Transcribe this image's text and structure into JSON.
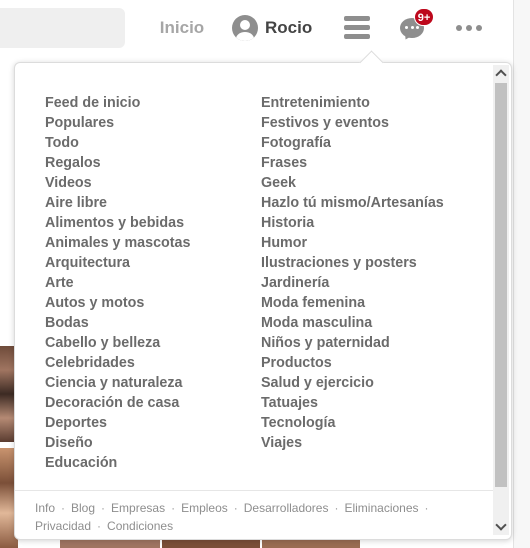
{
  "header": {
    "search_placeholder": "",
    "home_label": "Inicio",
    "profile_name": "Rocio",
    "notifications_badge": "9+"
  },
  "icons": {
    "avatar": "user-avatar-icon",
    "menu": "hamburger-menu-icon",
    "messages": "chat-bubble-icon",
    "more": "more-options-icon"
  },
  "colors": {
    "badge": "#bd081c",
    "category_text": "#6b6b6b",
    "footer_text": "#8e8e8e"
  },
  "categories": {
    "left": [
      "Feed de inicio",
      "Populares",
      "Todo",
      "Regalos",
      "Videos",
      "Aire libre",
      "Alimentos y bebidas",
      "Animales y mascotas",
      "Arquitectura",
      "Arte",
      "Autos y motos",
      "Bodas",
      "Cabello y belleza",
      "Celebridades",
      "Ciencia y naturaleza",
      "Decoración de casa",
      "Deportes",
      "Diseño",
      "Educación"
    ],
    "right": [
      "Entretenimiento",
      "Festivos y eventos",
      "Fotografía",
      "Frases",
      "Geek",
      "Hazlo tú mismo/Artesanías",
      "Historia",
      "Humor",
      "Ilustraciones y posters",
      "Jardinería",
      "Moda femenina",
      "Moda masculina",
      "Niños y paternidad",
      "Productos",
      "Salud y ejercicio",
      "Tatuajes",
      "Tecnología",
      "Viajes"
    ]
  },
  "footer": {
    "links": [
      "Info",
      "Blog",
      "Empresas",
      "Empleos",
      "Desarrolladores",
      "Eliminaciones",
      "Privacidad",
      "Condiciones"
    ],
    "separator": "·"
  }
}
